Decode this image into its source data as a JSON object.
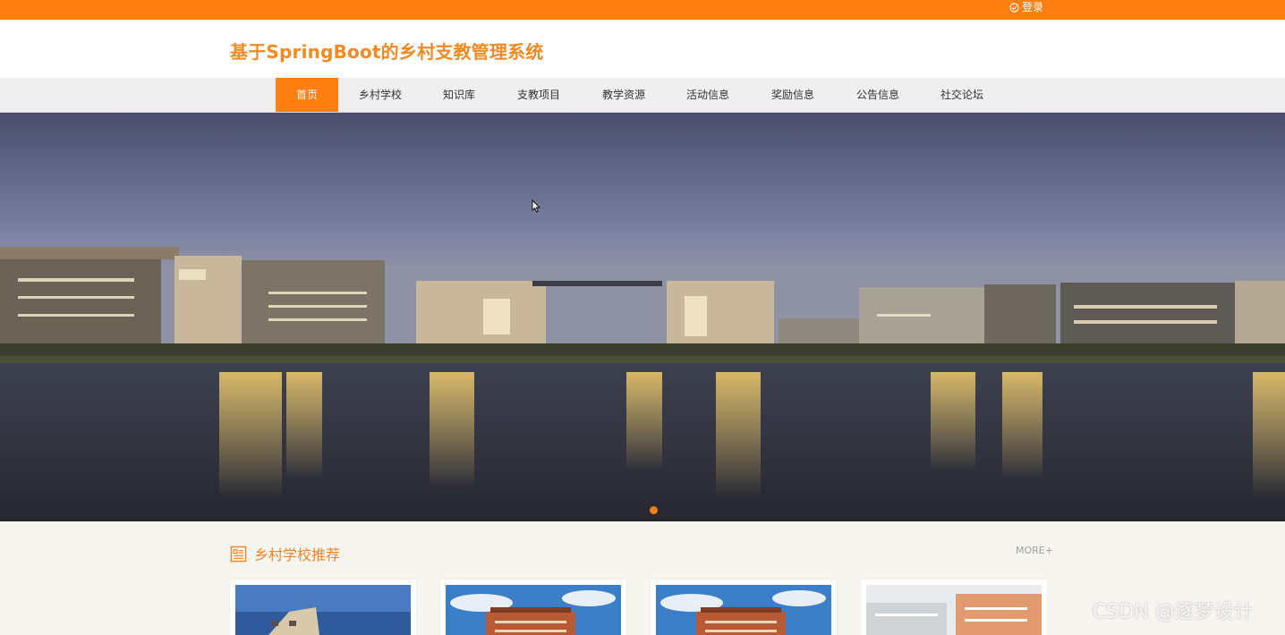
{
  "topbar": {
    "login_label": "登录",
    "accent_color": "#ff7f10"
  },
  "header": {
    "site_title": "基于SpringBoot的乡村支教管理系统"
  },
  "nav": {
    "items": [
      {
        "label": "首页",
        "active": true
      },
      {
        "label": "乡村学校"
      },
      {
        "label": "知识库"
      },
      {
        "label": "支教项目"
      },
      {
        "label": "教学资源"
      },
      {
        "label": "活动信息"
      },
      {
        "label": "奖励信息"
      },
      {
        "label": "公告信息"
      },
      {
        "label": "社交论坛"
      }
    ]
  },
  "banner": {
    "current_slide": 1,
    "slide_count": 1
  },
  "section": {
    "title": "乡村学校推荐",
    "more_label": "MORE+",
    "icon": "list-box-icon",
    "cards": 4
  },
  "watermark": {
    "text": "CSDN @逐梦设计"
  }
}
